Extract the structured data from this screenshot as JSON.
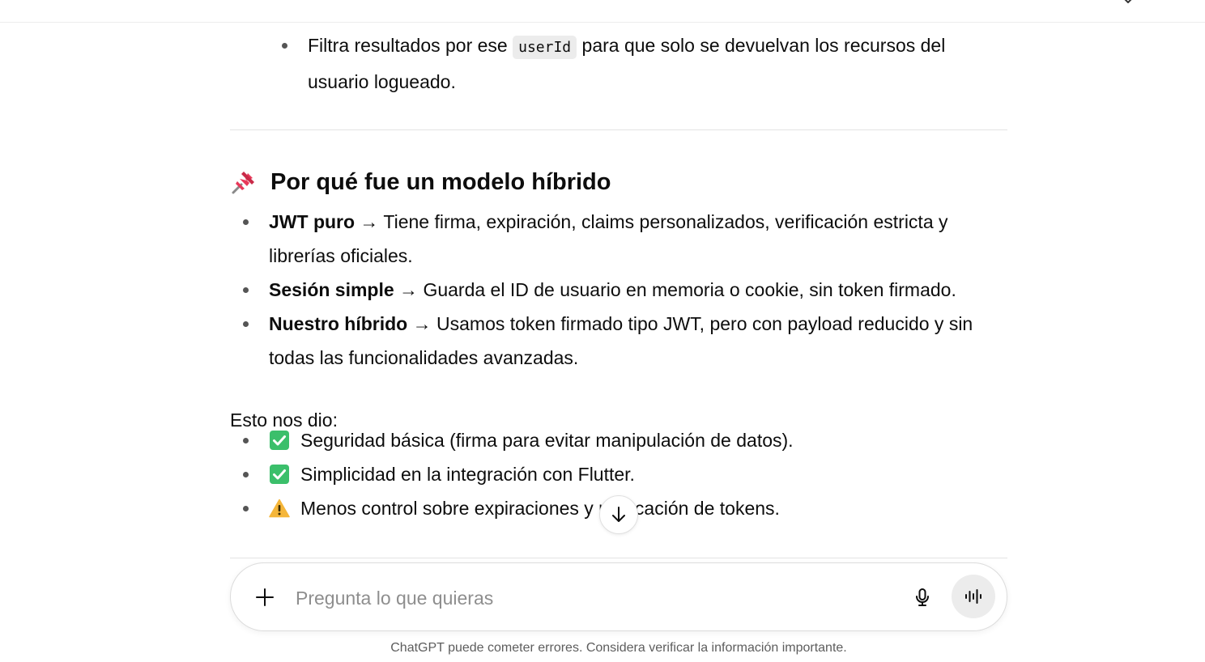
{
  "prev_item": {
    "pre": "Filtra resultados por ese ",
    "code": "userId",
    "post": " para que solo se devuelvan los recursos del usuario logueado."
  },
  "section": {
    "icon": "pushpin-icon",
    "title": "Por qué fue un modelo híbrido",
    "models": [
      {
        "name": "JWT puro",
        "desc": " → Tiene firma, expiración, claims personalizados, verificación estricta y librerías oficiales."
      },
      {
        "name": "Sesión simple",
        "desc": " → Guarda el ID de usuario en memoria o cookie, sin token firmado."
      },
      {
        "name": "Nuestro híbrido",
        "desc": " → Usamos token firmado tipo JWT, pero con payload reducido y sin todas las funcionalidades avanzadas."
      }
    ],
    "result_intro": "Esto nos dio:",
    "results": [
      {
        "icon": "check-mark-button-icon",
        "text": "Seguridad básica (firma para evitar manipulación de datos)."
      },
      {
        "icon": "check-mark-button-icon",
        "text": "Simplicidad en la integración con Flutter."
      },
      {
        "icon": "warning-icon",
        "text": "Menos control sobre expiraciones y revocación de tokens."
      }
    ]
  },
  "composer": {
    "placeholder": "Pregunta lo que quieras",
    "value": ""
  },
  "footer": {
    "disclaimer": "ChatGPT puede cometer errores. Considera verificar la información importante."
  },
  "colors": {
    "check": "#3bbf6b",
    "warning": "#f5b63a",
    "pin": "#e8395a"
  }
}
